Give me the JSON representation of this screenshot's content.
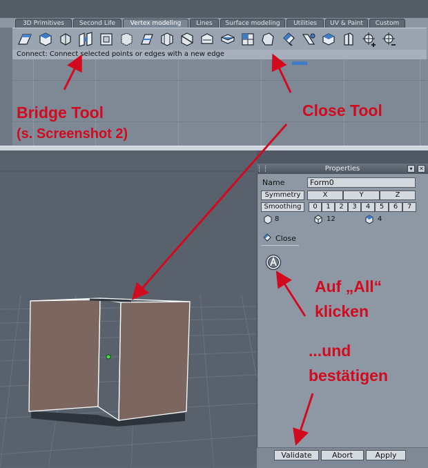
{
  "toolbar": {
    "tabs": [
      "3D Primitives",
      "Second Life",
      "Vertex modeling",
      "Lines",
      "Surface modeling",
      "Utilities",
      "UV & Paint",
      "Custom"
    ],
    "active_tab": "Vertex modeling",
    "status_text": "Connect: Connect selected points or edges with a new edge"
  },
  "properties": {
    "title": "Properties",
    "name_label": "Name",
    "name_value": "Form0",
    "symmetry_label": "Symmetry",
    "axes": [
      "X",
      "Y",
      "Z"
    ],
    "smoothing_label": "Smoothing",
    "smoothing_levels": [
      "0",
      "1",
      "2",
      "3",
      "4",
      "5",
      "6",
      "7"
    ],
    "counts": [
      "8",
      "12",
      "4"
    ],
    "tool_label": "Close",
    "validate_label": "Validate",
    "abort_label": "Abort",
    "apply_label": "Apply"
  },
  "annotations": {
    "bridge_tool": "Bridge Tool",
    "bridge_ref": "(s. Screenshot 2)",
    "close_tool": "Close Tool",
    "click_all_line1": "Auf „All“",
    "click_all_line2": "klicken",
    "confirm_line1": "...und",
    "confirm_line2": "bestätigen"
  },
  "colors": {
    "annotation": "#d10a1e",
    "panel": "#8e98a5",
    "face": "#7b6660"
  }
}
